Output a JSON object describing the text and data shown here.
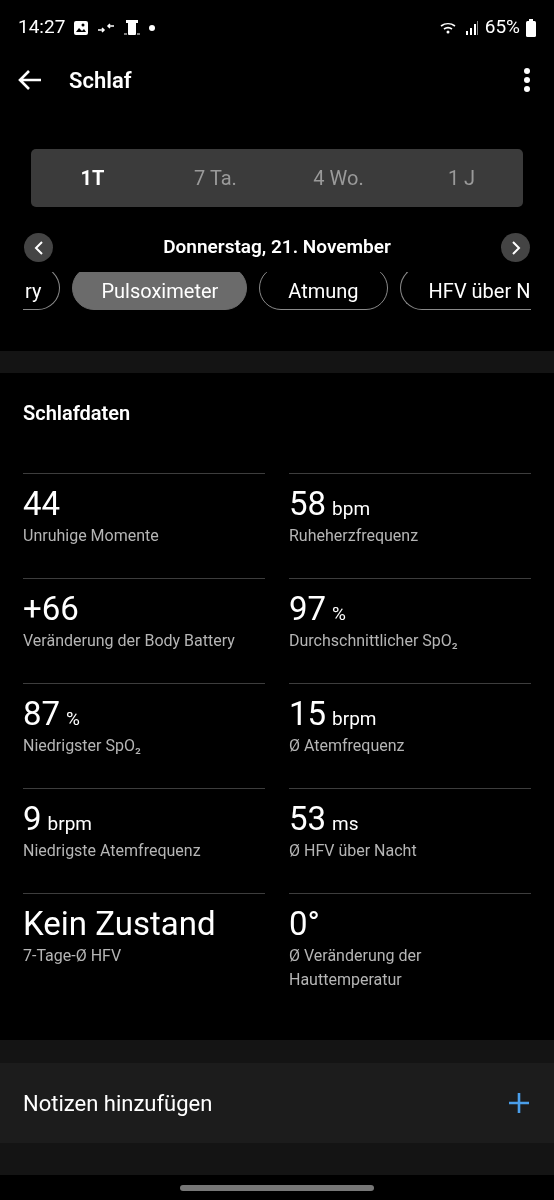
{
  "status_bar": {
    "time": "14:27",
    "battery": "65%"
  },
  "header": {
    "title": "Schlaf"
  },
  "range_tabs": [
    {
      "label": "1T",
      "selected": true
    },
    {
      "label": "7 Ta.",
      "selected": false
    },
    {
      "label": "4 Wo.",
      "selected": false
    },
    {
      "label": "1 J",
      "selected": false
    }
  ],
  "date": "Donnerstag, 21. November",
  "chips": [
    {
      "label": "ry",
      "selected": false,
      "cut_left": true,
      "cut_right": false
    },
    {
      "label": "Pulsoximeter",
      "selected": true,
      "cut_left": false,
      "cut_right": false
    },
    {
      "label": "Atmung",
      "selected": false,
      "cut_left": false,
      "cut_right": false
    },
    {
      "label": "HFV über N",
      "selected": false,
      "cut_left": false,
      "cut_right": true
    }
  ],
  "section": {
    "title": "Schlafdaten",
    "metrics": [
      {
        "value": "44",
        "label": "Unruhige Momente"
      },
      {
        "value": "58",
        "unit": "bpm",
        "label": "Ruheherzfrequenz"
      },
      {
        "value": "+66",
        "label": "Veränderung der Body Battery"
      },
      {
        "value": "97",
        "unit": "%",
        "label": "Durchschnittlicher SpO₂"
      },
      {
        "value": "87",
        "unit": "%",
        "label": "Niedrigster SpO₂"
      },
      {
        "value": "15",
        "unit": "brpm",
        "label": "Ø Atemfrequenz"
      },
      {
        "value": "9",
        "unit": "brpm",
        "label": "Niedrigste Atemfrequenz"
      },
      {
        "value": "53",
        "unit": "ms",
        "label": "Ø HFV über Nacht"
      },
      {
        "value": "Kein Zustand",
        "label": "7-Tage-Ø HFV"
      },
      {
        "value": "0°",
        "label": "Ø Veränderung der Hauttemperatur"
      }
    ]
  },
  "notes": {
    "label": "Notizen hinzufügen"
  }
}
